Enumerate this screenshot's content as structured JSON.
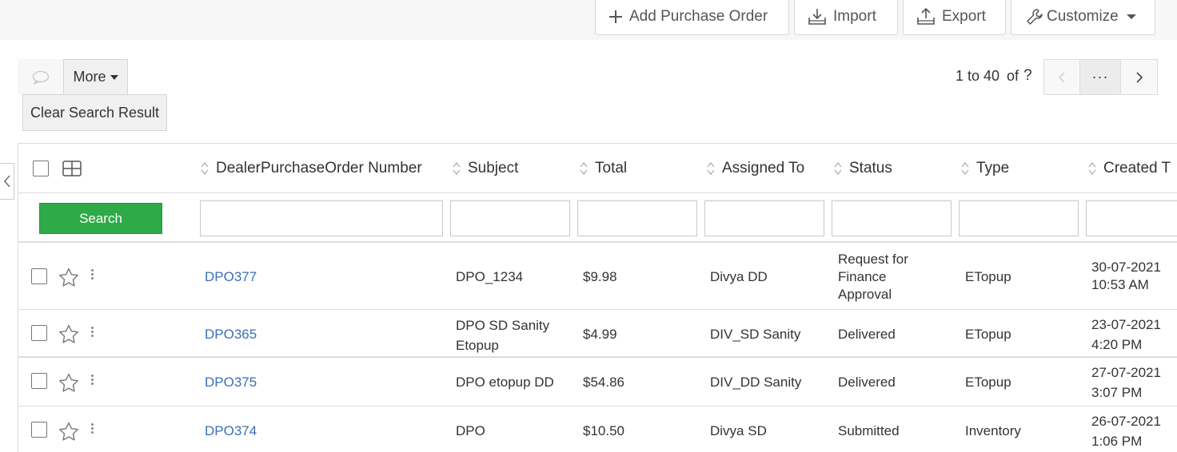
{
  "toolbar": {
    "add_label": "Add Purchase Order",
    "import_label": "Import",
    "export_label": "Export",
    "customize_label": "Customize"
  },
  "actions": {
    "more_label": "More",
    "clear_label": "Clear Search Result"
  },
  "pager": {
    "range": "1 to 40",
    "of_label": "of",
    "total": "?",
    "dots": "···"
  },
  "table": {
    "columns": [
      "DealerPurchaseOrder Number",
      "Subject",
      "Total",
      "Assigned To",
      "Status",
      "Type",
      "Created T"
    ],
    "search_label": "Search",
    "rows": [
      {
        "number": "DPO377",
        "subject": [
          "DPO_1234"
        ],
        "total": "$9.98",
        "assigned": "Divya DD",
        "status": [
          "Request for",
          "Finance",
          "Approval"
        ],
        "type": "ETopup",
        "created": [
          "30-07-2021",
          "10:53 AM"
        ]
      },
      {
        "number": "DPO365",
        "subject": [
          "DPO SD Sanity",
          "Etopup"
        ],
        "total": "$4.99",
        "assigned": "DIV_SD Sanity",
        "status": [
          "Delivered"
        ],
        "type": "ETopup",
        "created": [
          "23-07-2021",
          "4:20 PM"
        ]
      },
      {
        "number": "DPO375",
        "subject": [
          "DPO etopup DD"
        ],
        "total": "$54.86",
        "assigned": "DIV_DD Sanity",
        "status": [
          "Delivered"
        ],
        "type": "ETopup",
        "created": [
          "27-07-2021",
          "3:07 PM"
        ]
      },
      {
        "number": "DPO374",
        "subject": [
          "DPO"
        ],
        "total": "$10.50",
        "assigned": "Divya SD",
        "status": [
          "Submitted"
        ],
        "type": "Inventory",
        "created": [
          "26-07-2021",
          "1:06 PM"
        ]
      }
    ]
  },
  "icons": {
    "add": "plus-icon",
    "import": "import-icon",
    "export": "export-icon",
    "customize": "wrench-icon",
    "comment": "comment-icon",
    "columns": "column-layout-icon",
    "star": "star-icon",
    "kebab": "kebab-menu-icon"
  },
  "colors": {
    "search_button": "#2eaa48",
    "link": "#3b6fb6"
  }
}
